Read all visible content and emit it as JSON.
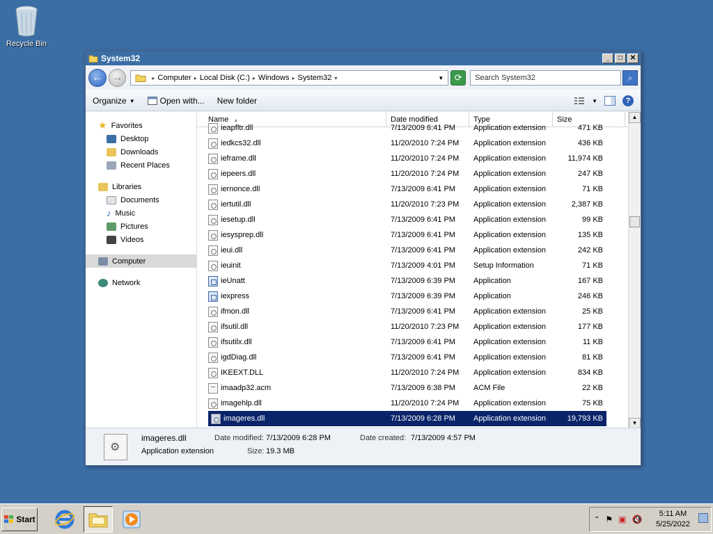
{
  "desktop": {
    "recycle_bin_label": "Recycle Bin"
  },
  "window": {
    "title": "System32",
    "controls": {
      "minimize": "_",
      "maximize": "□",
      "close": "✕"
    }
  },
  "navbar": {
    "breadcrumb": [
      "Computer",
      "Local Disk (C:)",
      "Windows",
      "System32"
    ],
    "search_placeholder": "Search System32"
  },
  "toolbar": {
    "organize": "Organize",
    "open_with": "Open with...",
    "new_folder": "New folder"
  },
  "nav_pane": {
    "favorites": {
      "label": "Favorites",
      "items": [
        "Desktop",
        "Downloads",
        "Recent Places"
      ]
    },
    "libraries": {
      "label": "Libraries",
      "items": [
        "Documents",
        "Music",
        "Pictures",
        "Videos"
      ]
    },
    "computer": "Computer",
    "network": "Network"
  },
  "columns": {
    "name": "Name",
    "date": "Date modified",
    "type": "Type",
    "size": "Size"
  },
  "files": [
    {
      "name": "ieapfltr.dll",
      "date": "7/13/2009 6:41 PM",
      "type": "Application extension",
      "size": "471 KB",
      "icon": "dll"
    },
    {
      "name": "iedkcs32.dll",
      "date": "11/20/2010 7:24 PM",
      "type": "Application extension",
      "size": "436 KB",
      "icon": "dll"
    },
    {
      "name": "ieframe.dll",
      "date": "11/20/2010 7:24 PM",
      "type": "Application extension",
      "size": "11,974 KB",
      "icon": "dll"
    },
    {
      "name": "iepeers.dll",
      "date": "11/20/2010 7:24 PM",
      "type": "Application extension",
      "size": "247 KB",
      "icon": "dll"
    },
    {
      "name": "iernonce.dll",
      "date": "7/13/2009 6:41 PM",
      "type": "Application extension",
      "size": "71 KB",
      "icon": "dll"
    },
    {
      "name": "iertutil.dll",
      "date": "11/20/2010 7:23 PM",
      "type": "Application extension",
      "size": "2,387 KB",
      "icon": "dll"
    },
    {
      "name": "iesetup.dll",
      "date": "7/13/2009 6:41 PM",
      "type": "Application extension",
      "size": "99 KB",
      "icon": "dll"
    },
    {
      "name": "iesysprep.dll",
      "date": "7/13/2009 6:41 PM",
      "type": "Application extension",
      "size": "135 KB",
      "icon": "dll"
    },
    {
      "name": "ieui.dll",
      "date": "7/13/2009 6:41 PM",
      "type": "Application extension",
      "size": "242 KB",
      "icon": "dll"
    },
    {
      "name": "ieuinit",
      "date": "7/13/2009 4:01 PM",
      "type": "Setup Information",
      "size": "71 KB",
      "icon": "inf"
    },
    {
      "name": "ieUnatt",
      "date": "7/13/2009 6:39 PM",
      "type": "Application",
      "size": "167 KB",
      "icon": "app"
    },
    {
      "name": "iexpress",
      "date": "7/13/2009 6:39 PM",
      "type": "Application",
      "size": "246 KB",
      "icon": "app"
    },
    {
      "name": "ifmon.dll",
      "date": "7/13/2009 6:41 PM",
      "type": "Application extension",
      "size": "25 KB",
      "icon": "dll"
    },
    {
      "name": "ifsutil.dll",
      "date": "11/20/2010 7:23 PM",
      "type": "Application extension",
      "size": "177 KB",
      "icon": "dll"
    },
    {
      "name": "ifsutilx.dll",
      "date": "7/13/2009 6:41 PM",
      "type": "Application extension",
      "size": "11 KB",
      "icon": "dll"
    },
    {
      "name": "igdDiag.dll",
      "date": "7/13/2009 6:41 PM",
      "type": "Application extension",
      "size": "81 KB",
      "icon": "dll"
    },
    {
      "name": "IKEEXT.DLL",
      "date": "11/20/2010 7:24 PM",
      "type": "Application extension",
      "size": "834 KB",
      "icon": "dll"
    },
    {
      "name": "imaadp32.acm",
      "date": "7/13/2009 6:38 PM",
      "type": "ACM File",
      "size": "22 KB",
      "icon": "txt"
    },
    {
      "name": "imagehlp.dll",
      "date": "11/20/2010 7:24 PM",
      "type": "Application extension",
      "size": "75 KB",
      "icon": "dll"
    },
    {
      "name": "imageres.dll",
      "date": "7/13/2009 6:28 PM",
      "type": "Application extension",
      "size": "19,793 KB",
      "icon": "dll",
      "selected": true
    }
  ],
  "details": {
    "name": "imageres.dll",
    "type": "Application extension",
    "date_modified_label": "Date modified:",
    "date_modified": "7/13/2009 6:28 PM",
    "date_created_label": "Date created:",
    "date_created": "7/13/2009 4:57 PM",
    "size_label": "Size:",
    "size": "19.3 MB"
  },
  "taskbar": {
    "start": "Start",
    "time": "5:11 AM",
    "date": "5/25/2022"
  }
}
